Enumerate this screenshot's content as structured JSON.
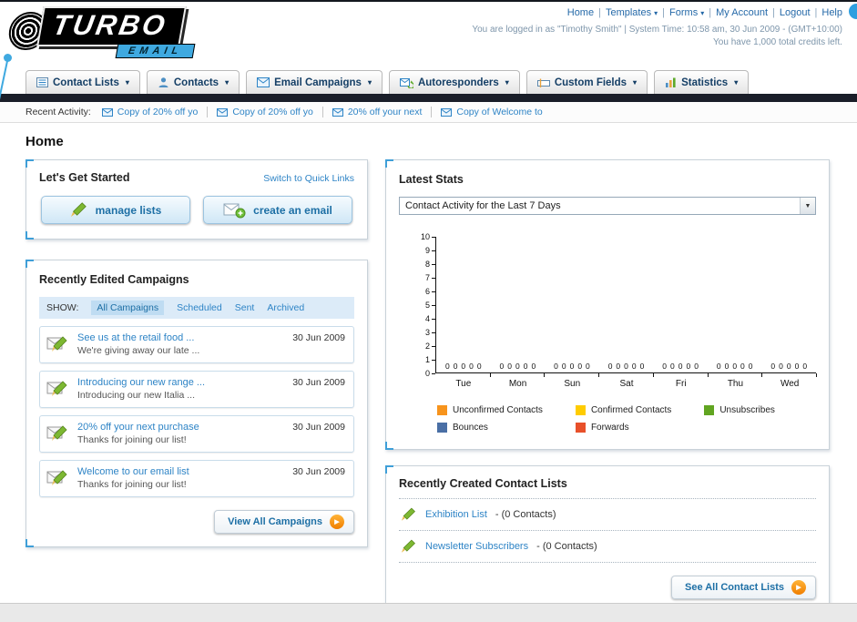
{
  "icons": {
    "chevron_down": "▾",
    "select_arrow": "▼",
    "go_arrow": "▶"
  },
  "header": {
    "logo_primary": "TURBO",
    "logo_secondary": "EMAIL",
    "nav_separator": "|",
    "nav": [
      {
        "label": "Home"
      },
      {
        "label": "Templates"
      },
      {
        "label": "Forms"
      },
      {
        "label": "My Account"
      },
      {
        "label": "Logout"
      },
      {
        "label": "Help"
      }
    ],
    "login_info": "You are logged in as \"Timothy Smith\" | System Time: 10:58 am, 30 Jun 2009 - (GMT+10:00)",
    "credits_info": "You have 1,000 total credits left."
  },
  "tabs": [
    {
      "label": "Contact Lists"
    },
    {
      "label": "Contacts"
    },
    {
      "label": "Email Campaigns"
    },
    {
      "label": "Autoresponders"
    },
    {
      "label": "Custom Fields"
    },
    {
      "label": "Statistics"
    }
  ],
  "recent_activity": {
    "label": "Recent Activity:",
    "items": [
      {
        "text": "Copy of 20% off yo"
      },
      {
        "text": "Copy of 20% off yo"
      },
      {
        "text": "20% off your next"
      },
      {
        "text": "Copy of Welcome to"
      }
    ]
  },
  "page": {
    "title": "Home"
  },
  "get_started": {
    "title": "Let's Get Started",
    "switch_link": "Switch to Quick Links",
    "manage_lists_label": "manage lists",
    "create_email_label": "create an email"
  },
  "campaigns": {
    "title": "Recently Edited Campaigns",
    "show_label": "SHOW:",
    "filters": [
      {
        "label": "All Campaigns",
        "selected": true
      },
      {
        "label": "Scheduled",
        "selected": false
      },
      {
        "label": "Sent",
        "selected": false
      },
      {
        "label": "Archived",
        "selected": false
      }
    ],
    "items": [
      {
        "title": "See us at the retail food ...",
        "subtitle": "We're giving away our late ...",
        "date": "30 Jun 2009"
      },
      {
        "title": "Introducing our new range ...",
        "subtitle": "Introducing our new Italia ...",
        "date": "30 Jun 2009"
      },
      {
        "title": "20% off your next purchase",
        "subtitle": "Thanks for joining our list!",
        "date": "30 Jun 2009"
      },
      {
        "title": "Welcome to our email list",
        "subtitle": "Thanks for joining our list!",
        "date": "30 Jun 2009"
      }
    ],
    "view_all_label": "View All Campaigns"
  },
  "stats": {
    "title": "Latest Stats",
    "period_selected": "Contact Activity for the Last 7 Days"
  },
  "chart_data": {
    "type": "bar",
    "title": "Contact Activity for the Last 7 Days",
    "categories": [
      "Tue",
      "Mon",
      "Sun",
      "Sat",
      "Fri",
      "Thu",
      "Wed"
    ],
    "series": [
      {
        "name": "Unconfirmed Contacts",
        "color": "#F7941D",
        "values": [
          0,
          0,
          0,
          0,
          0,
          0,
          0
        ]
      },
      {
        "name": "Confirmed Contacts",
        "color": "#FFCC00",
        "values": [
          0,
          0,
          0,
          0,
          0,
          0,
          0
        ]
      },
      {
        "name": "Unsubscribes",
        "color": "#61A521",
        "values": [
          0,
          0,
          0,
          0,
          0,
          0,
          0
        ]
      },
      {
        "name": "Bounces",
        "color": "#4A6FA5",
        "values": [
          0,
          0,
          0,
          0,
          0,
          0,
          0
        ]
      },
      {
        "name": "Forwards",
        "color": "#E8502A",
        "values": [
          0,
          0,
          0,
          0,
          0,
          0,
          0
        ]
      }
    ],
    "ylim": [
      0,
      10
    ],
    "ytick_step": 1,
    "grid": false,
    "legend_position": "bottom",
    "value_labels_shown": true
  },
  "contact_lists": {
    "title": "Recently Created Contact Lists",
    "items": [
      {
        "name": "Exhibition List",
        "suffix": "- (0 Contacts)"
      },
      {
        "name": "Newsletter Subscribers",
        "suffix": "- (0 Contacts)"
      }
    ],
    "see_all_label": "See All Contact Lists"
  }
}
